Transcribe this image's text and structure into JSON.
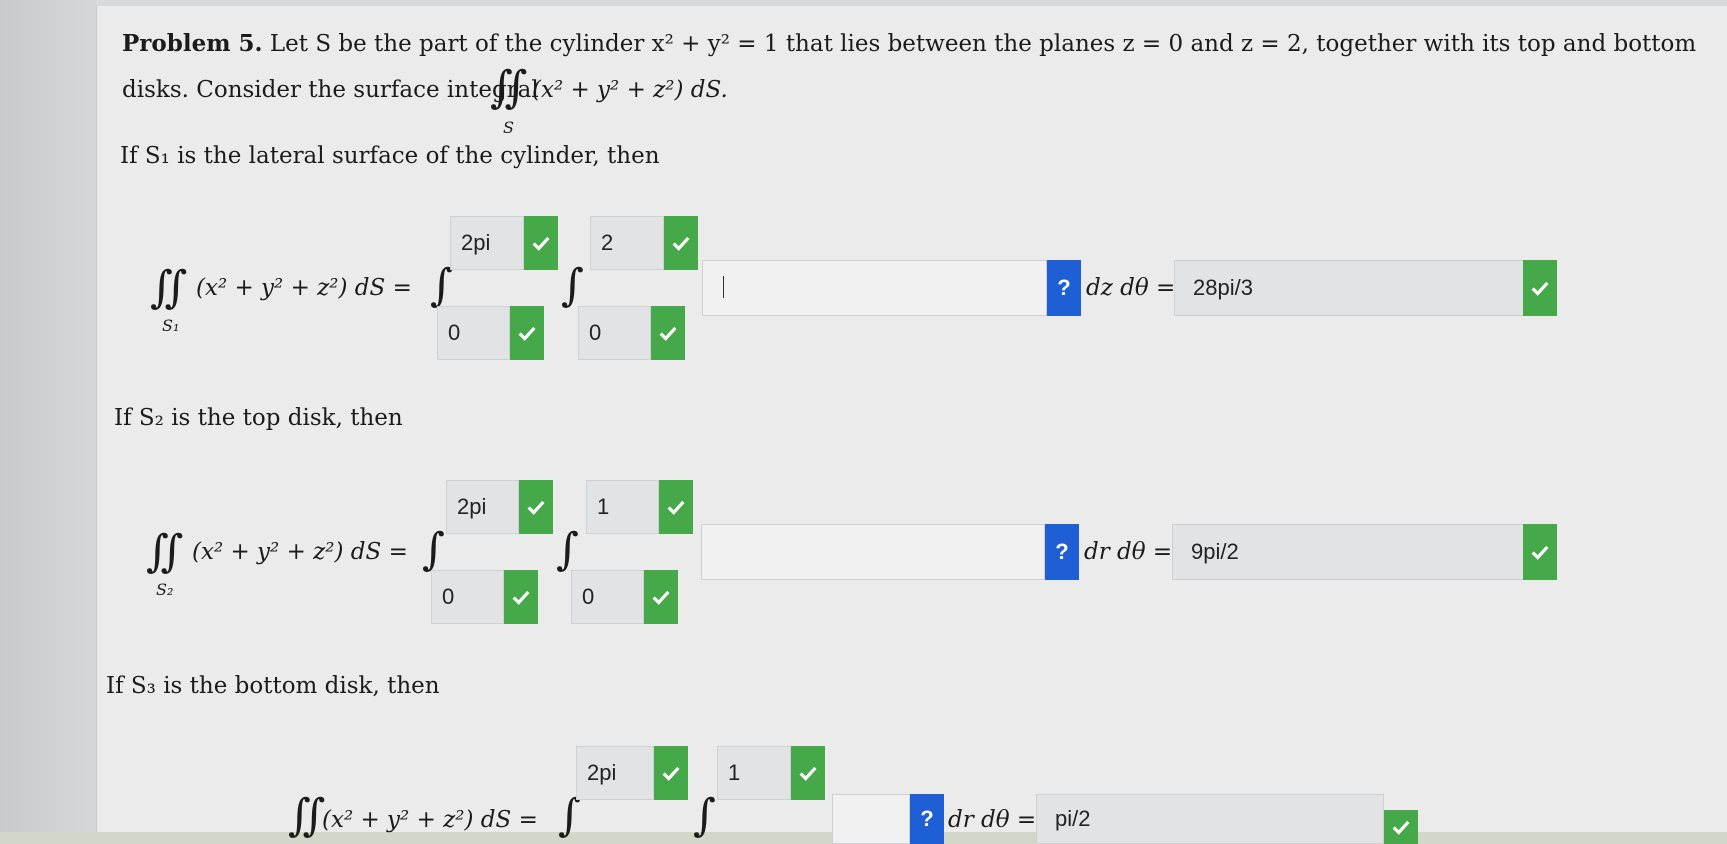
{
  "problem": {
    "heading": "Problem 5.",
    "line1": "Let S be the part of the cylinder x² + y² = 1 that lies between the planes z = 0 and z = 2, together with its top and bottom",
    "line2": "disks. Consider the surface integral",
    "integrand": "(x² + y² + z²) dS.",
    "surface_under": "S"
  },
  "part1": {
    "intro": "If S₁ is the lateral surface of the cylinder, then",
    "lhs": "(x² + y² + z²) dS =",
    "sub": "S₁",
    "outer_upper": "2pi",
    "outer_lower": "0",
    "inner_upper": "2",
    "inner_lower": "0",
    "integrand_value": "",
    "differentials": "dz dθ =",
    "result": "28pi/3"
  },
  "part2": {
    "intro": "If S₂ is the top disk, then",
    "lhs": "(x² + y² + z²) dS =",
    "sub": "S₂",
    "outer_upper": "2pi",
    "outer_lower": "0",
    "inner_upper": "1",
    "inner_lower": "0",
    "integrand_value": "",
    "differentials": "dr dθ =",
    "result": "9pi/2"
  },
  "part3": {
    "intro": "If S₃ is the bottom disk, then",
    "lhs": "(x² + y² + z²) dS =",
    "outer_upper": "2pi",
    "inner_upper": "1",
    "integrand_value": "",
    "differentials": "dr dθ =",
    "result": "pi/2"
  },
  "icons": {
    "check": "check-icon",
    "help": "question-mark-icon"
  },
  "colors": {
    "check_green": "#46a949",
    "help_blue": "#1f5fd6"
  }
}
